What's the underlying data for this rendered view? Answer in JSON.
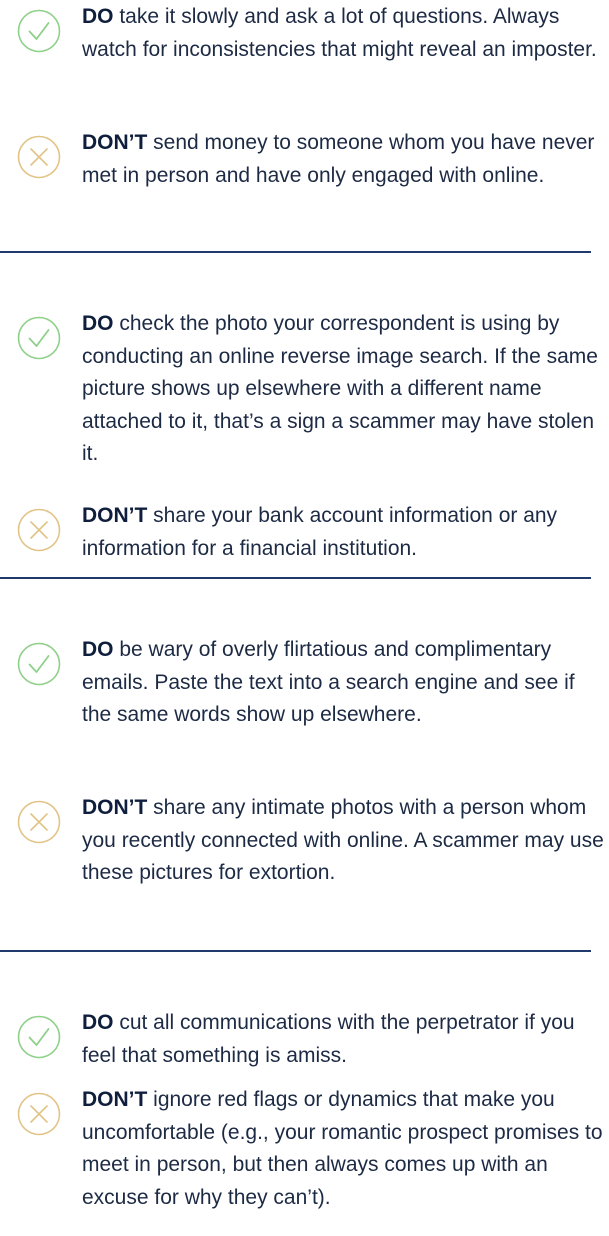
{
  "sections": [
    {
      "do": {
        "keyword": "DO",
        "text": " take it slowly and ask a lot of questions. Always watch for inconsistencies that might reveal an imposter."
      },
      "dont": {
        "keyword": "DON’T",
        "text": " send money to someone whom you have never met in person and have only engaged with online."
      }
    },
    {
      "do": {
        "keyword": "DO",
        "text": " check the photo your correspondent is using by conducting an online reverse image search. If the same picture shows up elsewhere with a different name attached to it, that’s a sign a scammer may have stolen it."
      },
      "dont": {
        "keyword": "DON’T",
        "text": " share your bank account information or any information for a financial institution."
      }
    },
    {
      "do": {
        "keyword": "DO",
        "text": " be wary of overly flirtatious and complimentary emails. Paste the text into a search engine and see if the same words show up elsewhere."
      },
      "dont": {
        "keyword": "DON’T",
        "text": " share any intimate photos with a person whom you recently connected with online. A scammer may use these pictures for extortion."
      }
    },
    {
      "do": {
        "keyword": "DO",
        "text": " cut all communications with the perpetrator if you feel that something is amiss."
      },
      "dont": {
        "keyword": "DON’T",
        "text": " ignore red flags or dynamics that make you uncomfortable (e.g., your romantic prospect promises to meet in person, but then always comes up with an excuse for why they can’t)."
      }
    }
  ],
  "colors": {
    "do_icon": "#8fd08a",
    "dont_icon": "#e2c487",
    "text": "#1d2a44",
    "divider": "#1f3a6b"
  },
  "icons": {
    "do": "check-circle-icon",
    "dont": "x-circle-icon"
  }
}
